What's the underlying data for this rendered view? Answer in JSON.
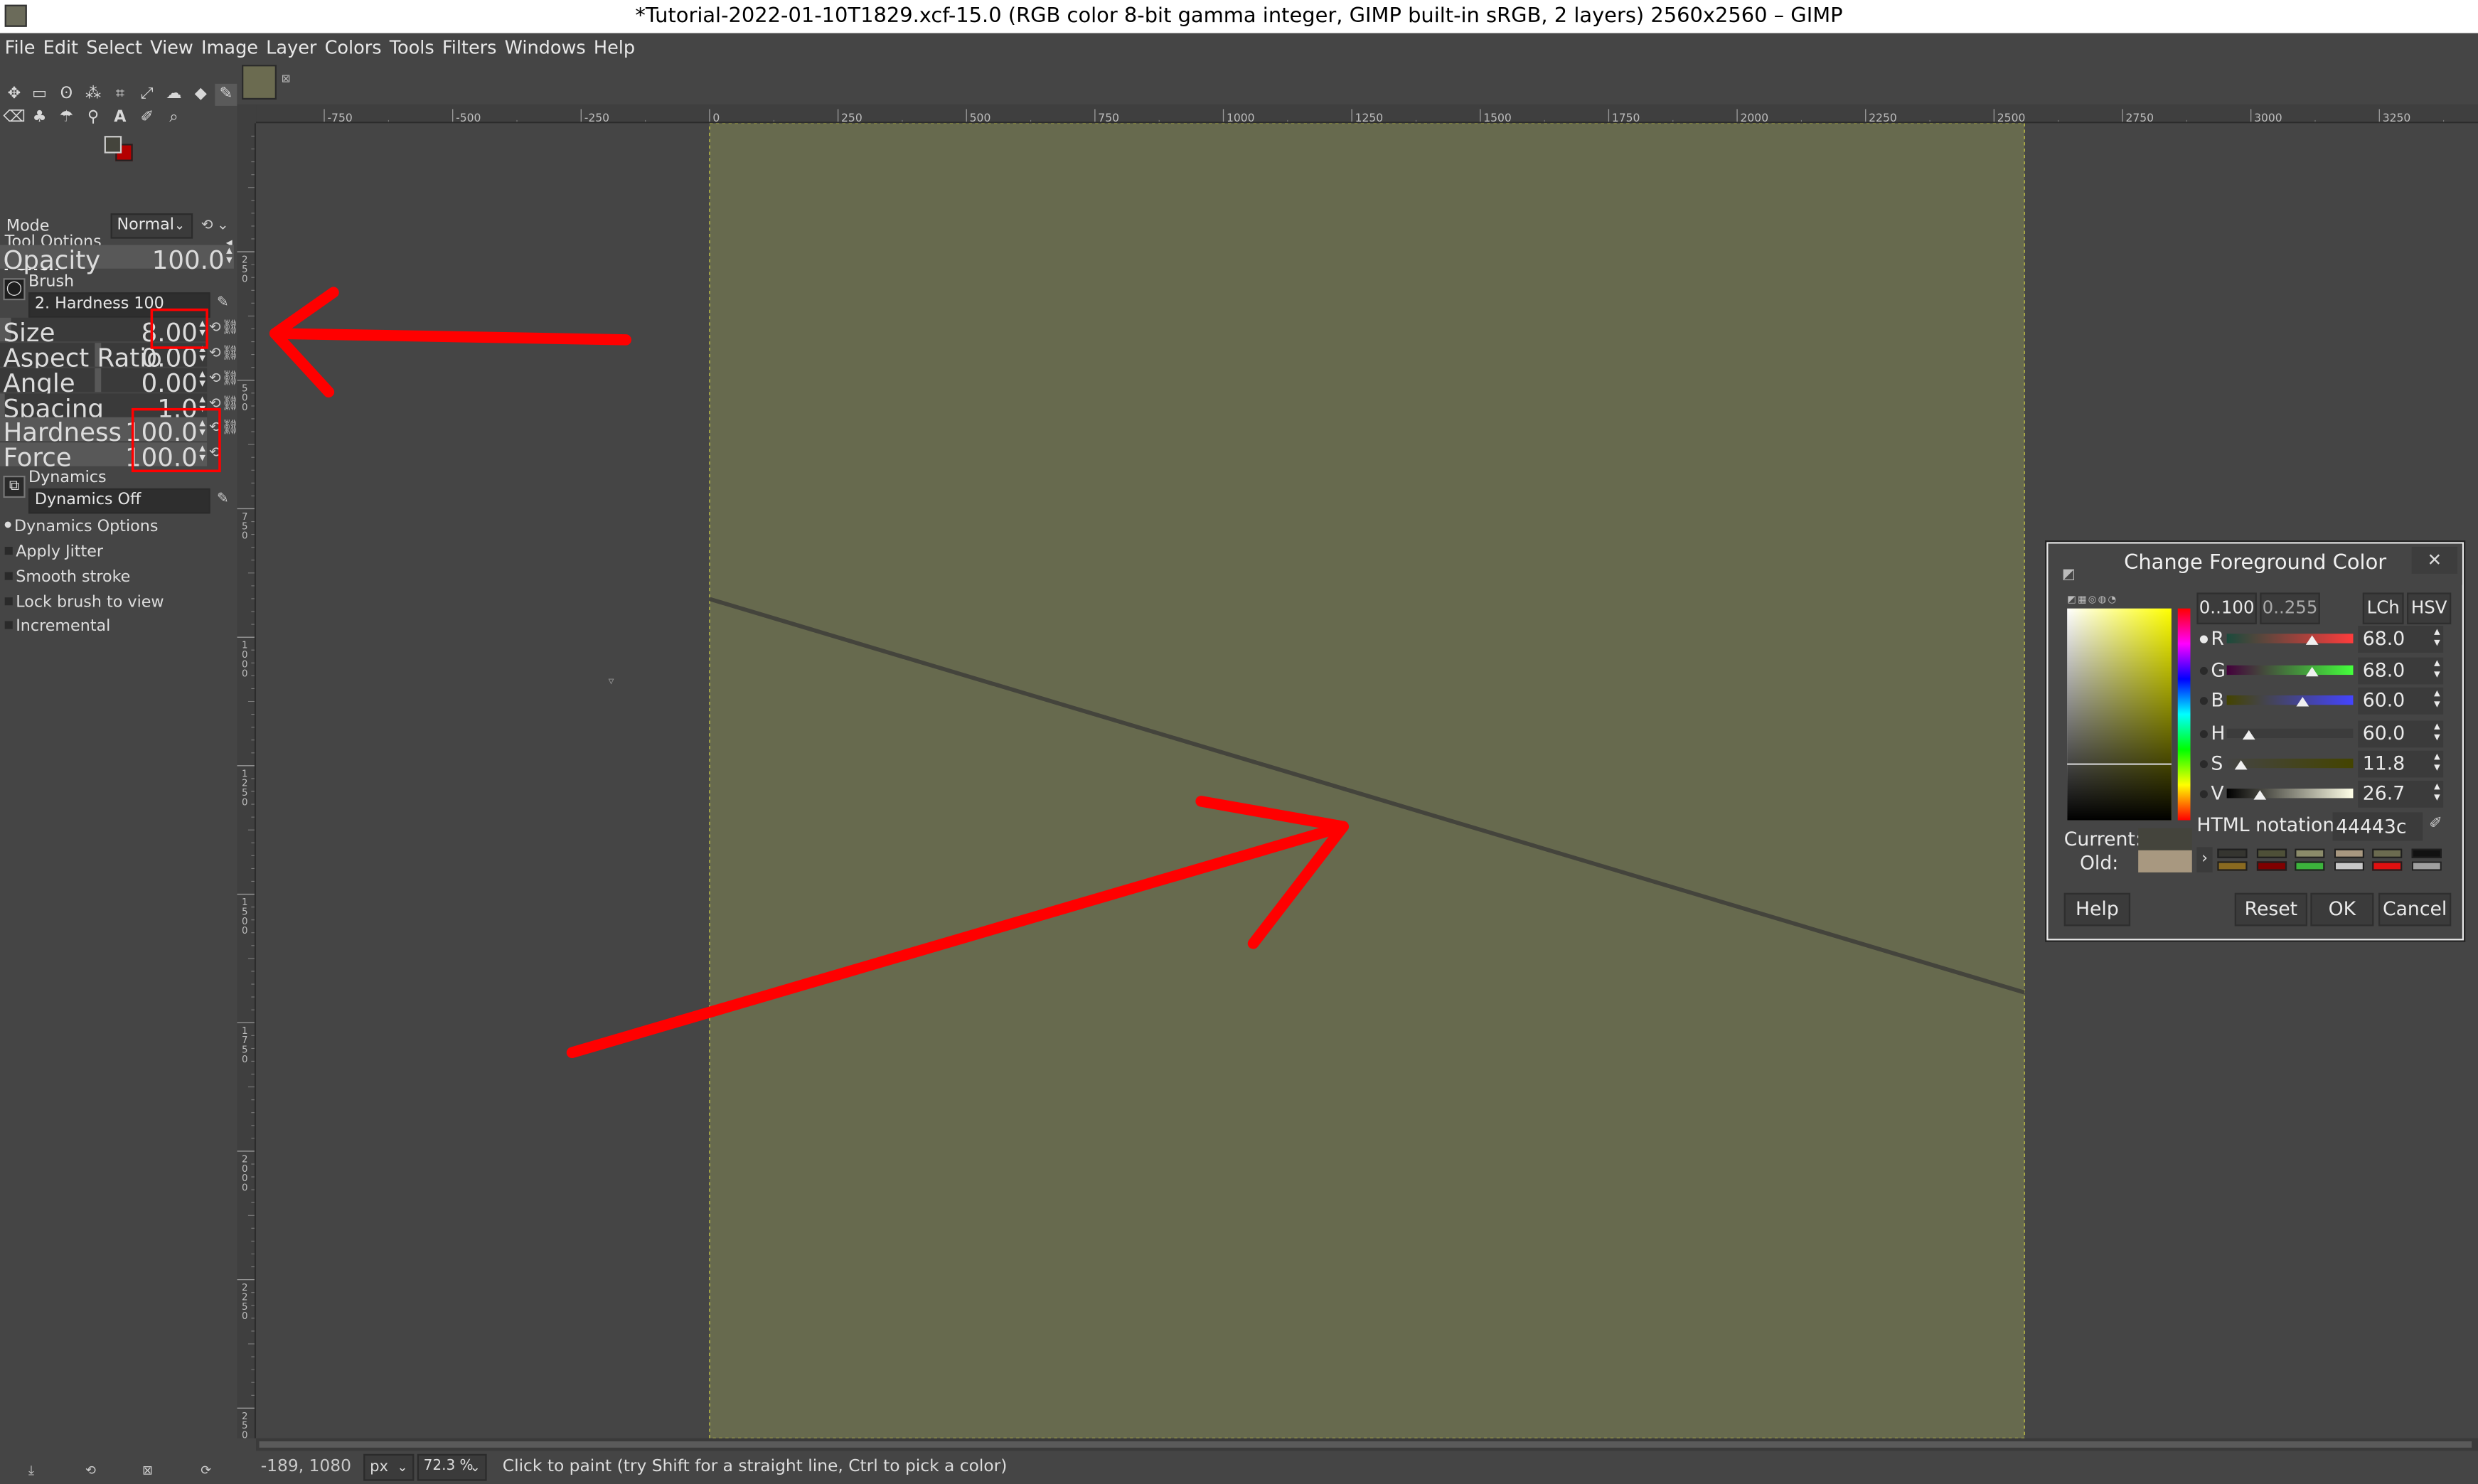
{
  "window": {
    "title": "*Tutorial-2022-01-10T1829.xcf-15.0 (RGB color 8-bit gamma integer, GIMP built-in sRGB, 2 layers) 2560x2560 – GIMP"
  },
  "menu": [
    "File",
    "Edit",
    "Select",
    "View",
    "Image",
    "Layer",
    "Colors",
    "Tools",
    "Filters",
    "Windows",
    "Help"
  ],
  "colors": {
    "canvas": "#676a4e",
    "stroke": "#44443c",
    "annotation": "#ff0000",
    "foreground": "#44443c",
    "background": "#b40000"
  },
  "tool_options": {
    "panel_title": "Tool Options",
    "tool_name": "Pencil",
    "mode_label": "Mode",
    "mode_value": "Normal",
    "opacity": {
      "label": "Opacity",
      "value": "100.0",
      "fraction": 1.0
    },
    "brush_label": "Brush",
    "brush_value": "2. Hardness 100",
    "size": {
      "label": "Size",
      "value": "8.00",
      "fraction": 0.05
    },
    "aspect": {
      "label": "Aspect Ratio",
      "value": "0.00",
      "fraction": 0.5
    },
    "angle": {
      "label": "Angle",
      "value": "0.00",
      "fraction": 0.5
    },
    "spacing": {
      "label": "Spacing",
      "value": "1.0",
      "fraction": 0.02
    },
    "hardness": {
      "label": "Hardness",
      "value": "100.0",
      "fraction": 1.0
    },
    "force": {
      "label": "Force",
      "value": "100.0",
      "fraction": 1.0
    },
    "dynamics_label": "Dynamics",
    "dynamics_value": "Dynamics Off",
    "options": [
      "Dynamics Options",
      "Apply Jitter",
      "Smooth stroke",
      "Lock brush to view",
      "Incremental"
    ]
  },
  "ruler_top_ticks": [
    "-750",
    "-500",
    "-250",
    "0",
    "250",
    "500",
    "750",
    "1000",
    "1250",
    "1500",
    "1750",
    "2000",
    "2250",
    "2500",
    "2750",
    "3000",
    "3250"
  ],
  "ruler_left_ticks": [
    "2\n5\n0",
    "5\n0\n0",
    "7\n5\n0",
    "1\n0\n0\n0",
    "1\n2\n5\n0",
    "1\n5\n0\n0",
    "1\n7\n5\n0",
    "2\n0\n0\n0",
    "2\n2\n5\n0",
    "2\n5\n0\n0"
  ],
  "status": {
    "coords": "-189, 1080",
    "unit": "px",
    "zoom": "72.3 %",
    "message": "Click to paint (try Shift for a straight line, Ctrl to pick a color)"
  },
  "color_dialog": {
    "title": "Change Foreground Color",
    "range_100": "0..100",
    "range_255": "0..255",
    "lch": "LCh",
    "hsv": "HSV",
    "channels": [
      {
        "letter": "R",
        "value": "68.0",
        "fraction": 0.68,
        "from": "#1a4a3c",
        "to": "#ff3c3c"
      },
      {
        "letter": "G",
        "value": "68.0",
        "fraction": 0.68,
        "from": "#44003c",
        "to": "#44ff3c"
      },
      {
        "letter": "B",
        "value": "60.0",
        "fraction": 0.6,
        "from": "#444400",
        "to": "#4444ff"
      },
      {
        "letter": "H",
        "value": "60.0",
        "fraction": 0.17,
        "from": "#3c3c3c",
        "to": "#3c3c3c"
      },
      {
        "letter": "S",
        "value": "11.8",
        "fraction": 0.118,
        "from": "#444444",
        "to": "#444400"
      },
      {
        "letter": "V",
        "value": "26.7",
        "fraction": 0.267,
        "from": "#000000",
        "to": "#ffffe8"
      }
    ],
    "html_label": "HTML notation:",
    "html_value": "44443c",
    "current_label": "Current:",
    "old_label": "Old:",
    "current_color": "#44443c",
    "old_color": "#a89880",
    "history": [
      "#353530",
      "#4e5038",
      "#8b8b6a",
      "#a89880",
      "#6b6b50",
      "#111111",
      "#8a6a20",
      "#800000",
      "#3cb43c",
      "#c8c8c8",
      "#e01010",
      "#a0a0a0"
    ],
    "buttons": {
      "help": "Help",
      "reset": "Reset",
      "ok": "OK",
      "cancel": "Cancel"
    }
  }
}
